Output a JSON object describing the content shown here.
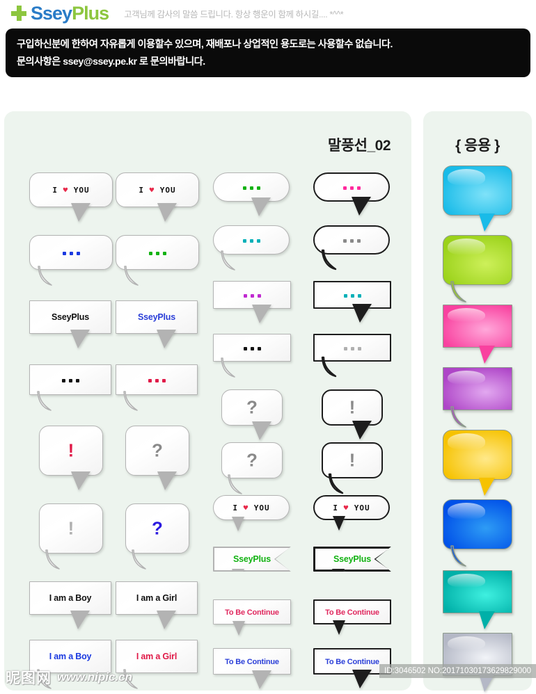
{
  "header": {
    "logo_plus_icon": "plus-icon",
    "logo_part1": "Ssey",
    "logo_part2": "Plus",
    "tagline": "고객님께 감사의 말씀 드립니다. 항상 행운이 함께 하시길.... *^^*"
  },
  "notice": {
    "line1": "구입하신분에 한하여 자유롭게 이용할수 있으며, 재배포나 상업적인 용도로는 사용할수 없습니다.",
    "line2": "문의사항은 ssey@ssey.pe.kr 로 문의바랍니다."
  },
  "main_panel": {
    "title": "말풍선_02"
  },
  "side_panel": {
    "title": "{ 응용 }"
  },
  "colors": {
    "bg_panel": "#edf4ee",
    "outline_soft": "#b3b3b3",
    "outline_hard": "#1d1d1d",
    "red": "#e8294a",
    "blue": "#1a39e0",
    "green": "#12b212",
    "black": "#111111",
    "gray": "#b0b0b0",
    "magenta": "#ff2a9d",
    "teal": "#00b0b8",
    "purple": "#c02ad0",
    "royal": "#2b3fd8",
    "crimson": "#e01a48"
  },
  "bubbles": [
    {
      "id": "c1r1",
      "text": "I ♥ YOU",
      "style": "pixel",
      "color": "#111111",
      "accent": "#e8294a",
      "outline": "soft"
    },
    {
      "id": "c1r2",
      "text": "• • •",
      "style": "dots",
      "color": "#1a39e0",
      "outline": "soft"
    },
    {
      "id": "c1r3",
      "text": "SseyPlus",
      "style": "plain",
      "color": "#111111",
      "outline": "soft"
    },
    {
      "id": "c1r4",
      "text": "• • •",
      "style": "dots",
      "color": "#111111",
      "outline": "soft"
    },
    {
      "id": "c1r5",
      "text": "!",
      "style": "mark",
      "color": "#e01a48",
      "outline": "soft"
    },
    {
      "id": "c1r6",
      "text": "!",
      "style": "mark",
      "color": "#b0b0b0",
      "outline": "soft"
    },
    {
      "id": "c1r7",
      "text": "I am a Boy",
      "style": "plain",
      "color": "#111111",
      "outline": "soft"
    },
    {
      "id": "c1r8",
      "text": "I am a Boy",
      "style": "plain",
      "color": "#1a39e0",
      "outline": "soft"
    },
    {
      "id": "c2r1",
      "text": "I ♥ YOU",
      "style": "pixel",
      "color": "#111111",
      "accent": "#e8294a",
      "outline": "soft"
    },
    {
      "id": "c2r2",
      "text": "• • •",
      "style": "dots",
      "color": "#12b212",
      "outline": "soft"
    },
    {
      "id": "c2r3",
      "text": "SseyPlus",
      "style": "plain",
      "color": "#2b3fd8",
      "outline": "soft"
    },
    {
      "id": "c2r4",
      "text": "• • •",
      "style": "dots",
      "color": "#e01a48",
      "outline": "soft"
    },
    {
      "id": "c2r5",
      "text": "?",
      "style": "mark",
      "color": "#8a8a8a",
      "outline": "soft"
    },
    {
      "id": "c2r6",
      "text": "?",
      "style": "mark",
      "color": "#2b1ae0",
      "outline": "soft"
    },
    {
      "id": "c2r7",
      "text": "I am a Girl",
      "style": "plain",
      "color": "#111111",
      "outline": "soft"
    },
    {
      "id": "c2r8",
      "text": "I am a Girl",
      "style": "plain",
      "color": "#e01a48",
      "outline": "soft"
    },
    {
      "id": "c3r1",
      "text": "• • •",
      "style": "dots",
      "color": "#12b212",
      "outline": "soft"
    },
    {
      "id": "c3r2",
      "text": "• • •",
      "style": "dots",
      "color": "#00b0b8",
      "outline": "soft"
    },
    {
      "id": "c3r3",
      "text": "• • •",
      "style": "dots",
      "color": "#c02ad0",
      "outline": "soft"
    },
    {
      "id": "c3r4",
      "text": "• • •",
      "style": "dots",
      "color": "#111111",
      "outline": "soft"
    },
    {
      "id": "c3r5",
      "text": "?",
      "style": "mark",
      "color": "#8a8a8a",
      "outline": "soft"
    },
    {
      "id": "c3r6",
      "text": "?",
      "style": "mark",
      "color": "#8a8a8a",
      "outline": "soft"
    },
    {
      "id": "c3r7",
      "text": "I ♥ YOU",
      "style": "pixel",
      "color": "#111111",
      "accent": "#e8294a",
      "outline": "soft"
    },
    {
      "id": "c3r8",
      "text": "SseyPlus",
      "style": "flag",
      "color": "#12b212",
      "outline": "soft"
    },
    {
      "id": "c3r9",
      "text": "To Be Continue",
      "style": "plain",
      "color": "#e0295f",
      "outline": "soft"
    },
    {
      "id": "c3r10",
      "text": "To Be Continue",
      "style": "plain",
      "color": "#2b3fd8",
      "outline": "soft"
    },
    {
      "id": "c4r1",
      "text": "• • •",
      "style": "dots",
      "color": "#ff2a9d",
      "outline": "hard"
    },
    {
      "id": "c4r2",
      "text": "• • •",
      "style": "dots",
      "color": "#8a8a8a",
      "outline": "hard"
    },
    {
      "id": "c4r3",
      "text": "• • •",
      "style": "dots",
      "color": "#00b0b8",
      "outline": "hard"
    },
    {
      "id": "c4r4",
      "text": "• • •",
      "style": "dots",
      "color": "#b0b0b0",
      "outline": "hard"
    },
    {
      "id": "c4r5",
      "text": "!",
      "style": "mark",
      "color": "#8a8a8a",
      "outline": "hard"
    },
    {
      "id": "c4r6",
      "text": "!",
      "style": "mark",
      "color": "#8a8a8a",
      "outline": "hard"
    },
    {
      "id": "c4r7",
      "text": "I ♥ YOU",
      "style": "pixel",
      "color": "#111111",
      "accent": "#e8294a",
      "outline": "hard"
    },
    {
      "id": "c4r8",
      "text": "SseyPlus",
      "style": "flag",
      "color": "#12b212",
      "outline": "hard"
    },
    {
      "id": "c4r9",
      "text": "To Be Continue",
      "style": "plain",
      "color": "#e0295f",
      "outline": "hard"
    },
    {
      "id": "c4r10",
      "text": "To Be Continue",
      "style": "plain",
      "color": "#2b3fd8",
      "outline": "hard"
    }
  ],
  "colored_bubbles": [
    {
      "id": "k1",
      "name": "cyan-bubble",
      "color_from": "#7fe2f9",
      "color_to": "#19bbe8",
      "shape": "round",
      "tail": "angle"
    },
    {
      "id": "k2",
      "name": "lime-bubble",
      "color_from": "#cdf05a",
      "color_to": "#9bd21a",
      "shape": "round",
      "tail": "curl"
    },
    {
      "id": "k3",
      "name": "pink-bubble",
      "color_from": "#ffa8da",
      "color_to": "#f9419f",
      "shape": "square",
      "tail": "angle"
    },
    {
      "id": "k4",
      "name": "purple-bubble",
      "color_from": "#e2a8f0",
      "color_to": "#ae45c7",
      "shape": "square",
      "tail": "curl"
    },
    {
      "id": "k5",
      "name": "yellow-bubble",
      "color_from": "#ffe98a",
      "color_to": "#f6c200",
      "shape": "round",
      "tail": "angle"
    },
    {
      "id": "k6",
      "name": "blue-bubble",
      "color_from": "#2e9cf5",
      "color_to": "#0050e8",
      "shape": "round",
      "tail": "curl"
    },
    {
      "id": "k7",
      "name": "turquoise-bubble",
      "color_from": "#3ff0e0",
      "color_to": "#00b0a8",
      "shape": "square",
      "tail": "angle"
    },
    {
      "id": "k8",
      "name": "silver-bubble",
      "color_from": "#f2f4f8",
      "color_to": "#b4b8c6",
      "shape": "square",
      "tail": "angle"
    }
  ],
  "footer": {
    "watermark_cn": "昵图网",
    "watermark_url": "www.nipic.cn",
    "id_text": "ID:3046502 NO:20171030173629829000"
  }
}
